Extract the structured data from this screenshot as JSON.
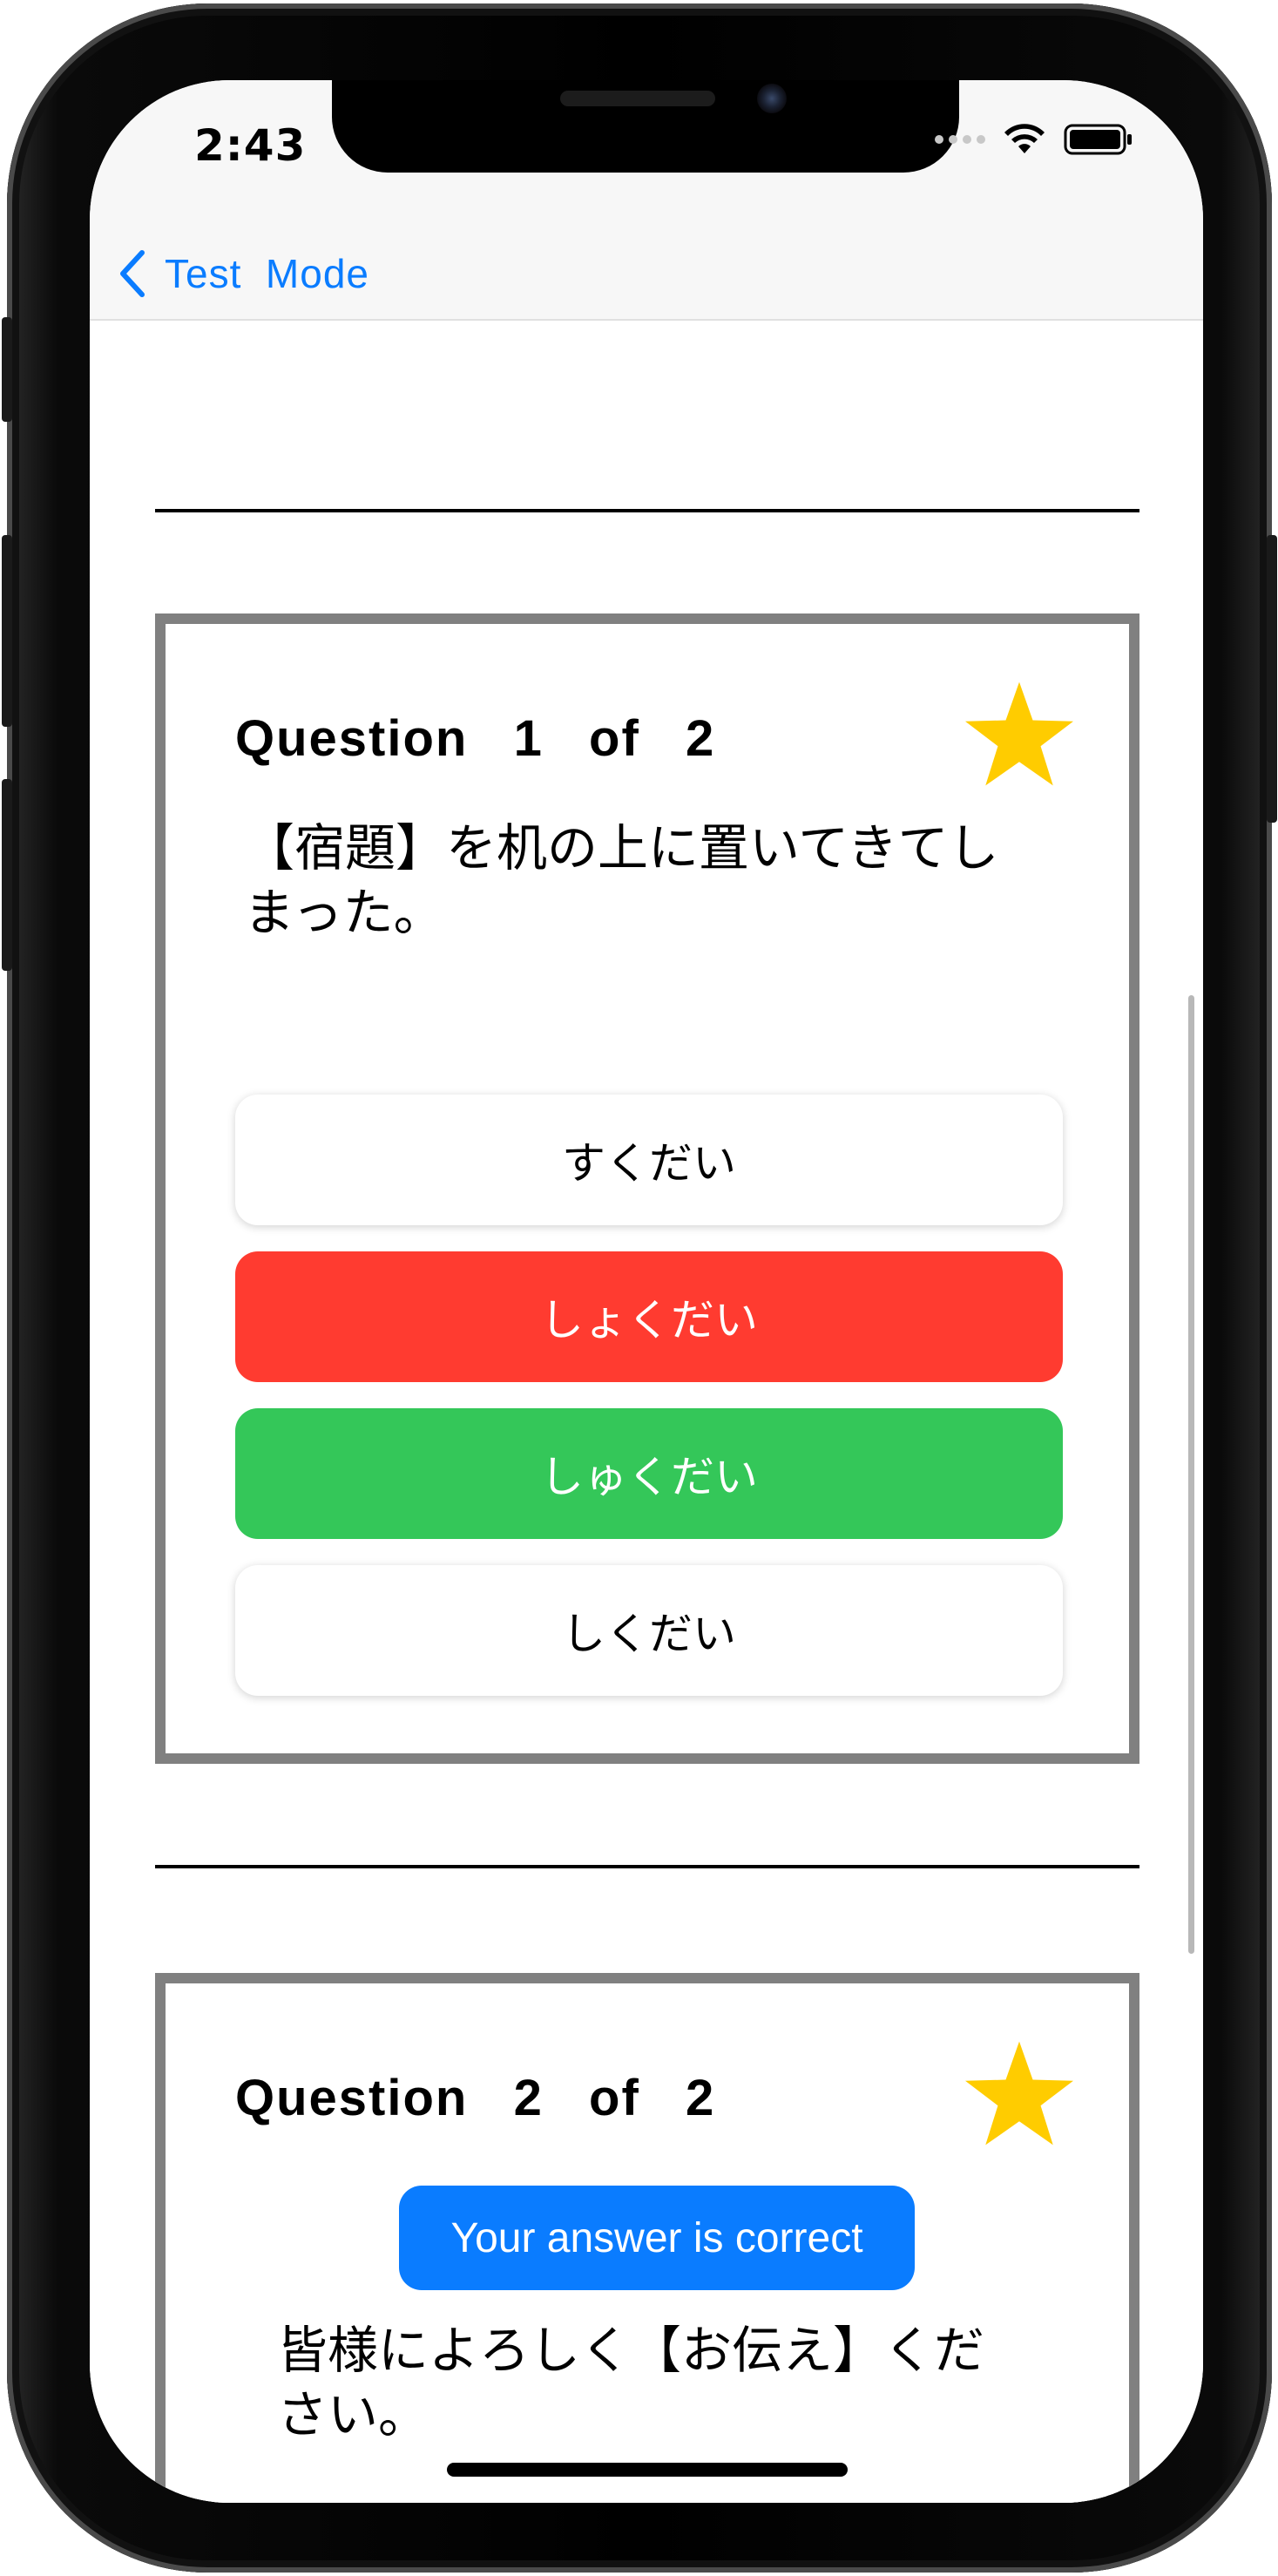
{
  "status_bar": {
    "time": "2:43"
  },
  "nav": {
    "back_label": "Test  Mode"
  },
  "questions": [
    {
      "title": "Question  1  of  2",
      "text": "【宿題】を机の上に置いてきてしまった。",
      "starred": true,
      "answers": [
        {
          "label": "すくだい",
          "state": "neutral"
        },
        {
          "label": "しょくだい",
          "state": "wrong"
        },
        {
          "label": "しゅくだい",
          "state": "correct"
        },
        {
          "label": "しくだい",
          "state": "neutral"
        }
      ]
    },
    {
      "title": "Question  2  of  2",
      "feedback": "Your answer is correct",
      "text": "皆様によろしく【お伝え】ください。",
      "starred": true
    }
  ],
  "colors": {
    "accent": "#0a7cff",
    "wrong": "#ff3b30",
    "correct": "#34c759",
    "star": "#ffcc00",
    "card_border": "#808080"
  },
  "icons": {
    "back": "chevron-left-icon",
    "star": "star-icon",
    "wifi": "wifi-icon",
    "battery": "battery-icon"
  }
}
